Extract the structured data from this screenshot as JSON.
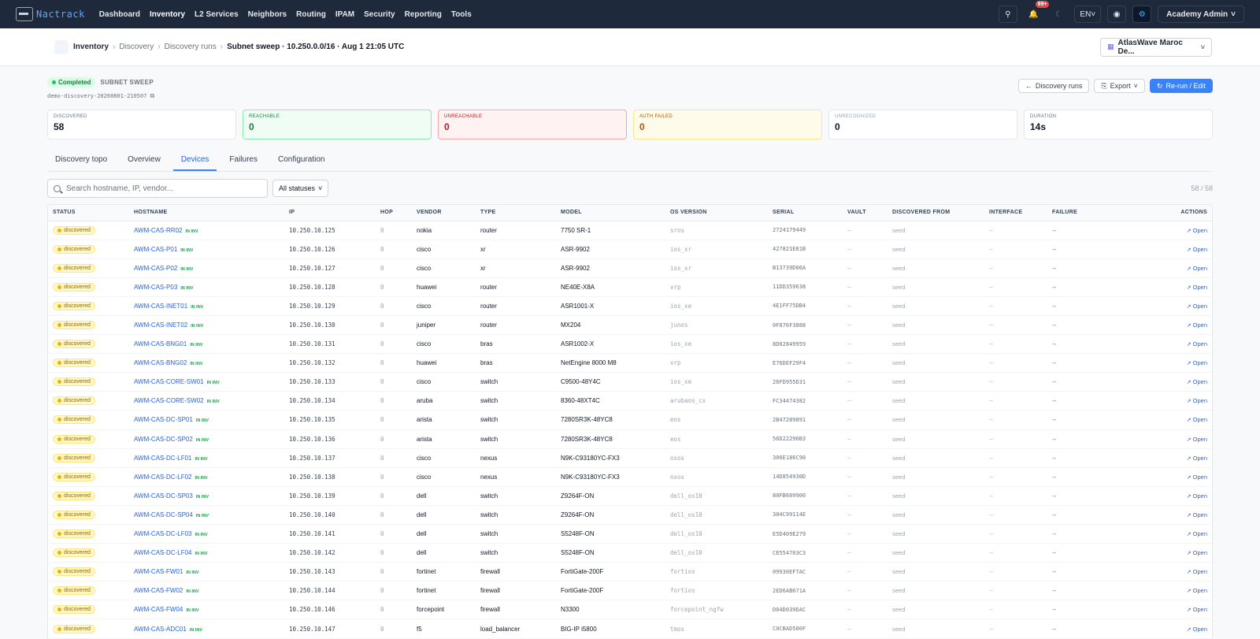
{
  "app": {
    "name": "Nactrack"
  },
  "nav": {
    "items": [
      "Dashboard",
      "Inventory",
      "L2 Services",
      "Neighbors",
      "Routing",
      "IPAM",
      "Security",
      "Reporting",
      "Tools"
    ],
    "notifications_badge": "99+",
    "language": "EN",
    "user": "Academy Admin"
  },
  "breadcrumb": [
    "Inventory",
    "Discovery",
    "Discovery runs",
    "Subnet sweep · 10.250.0.0/16 · Aug 1 21:05 UTC"
  ],
  "tenant": "AtlasWave Maroc De...",
  "run": {
    "status": "Completed",
    "kind": "SUBNET SWEEP",
    "id": "demo-discovery-20260801-210507"
  },
  "actions": {
    "back": "Discovery runs",
    "export": "Export",
    "rerun": "Re-run / Edit"
  },
  "stats": [
    {
      "label": "DISCOVERED",
      "value": "58",
      "tone": "default"
    },
    {
      "label": "REACHABLE",
      "value": "0",
      "tone": "green"
    },
    {
      "label": "UNREACHABLE",
      "value": "0",
      "tone": "red"
    },
    {
      "label": "AUTH FAILED",
      "value": "0",
      "tone": "yellow"
    },
    {
      "label": "UNRECOGNIZED",
      "value": "0",
      "tone": "grey"
    },
    {
      "label": "DURATION",
      "value": "14s",
      "tone": "default"
    }
  ],
  "tabs": [
    "Discovery topo",
    "Overview",
    "Devices",
    "Failures",
    "Configuration"
  ],
  "active_tab": 2,
  "toolbar": {
    "search_placeholder": "Search hostname, IP, vendor...",
    "status_filter": "All statuses",
    "count": "58 / 58"
  },
  "table": {
    "columns": [
      "STATUS",
      "HOSTNAME",
      "IP",
      "HOP",
      "VENDOR",
      "TYPE",
      "MODEL",
      "OS VERSION",
      "SERIAL",
      "VAULT",
      "DISCOVERED FROM",
      "INTERFACE",
      "FAILURE",
      "ACTIONS"
    ],
    "status_label": "discovered",
    "in_inv_label": "IN INV",
    "open_label": "Open",
    "dash": "--",
    "rows": [
      {
        "host": "AWM-CAS-RR02",
        "ip": "10.250.10.125",
        "hop": "0",
        "vendor": "nokia",
        "type": "router",
        "model": "7750 SR-1",
        "os": "sros",
        "serial": "2724179449",
        "from": "seed",
        "failure_red": false
      },
      {
        "host": "AWM-CAS-P01",
        "ip": "10.250.10.126",
        "hop": "0",
        "vendor": "cisco",
        "type": "xr",
        "model": "ASR-9902",
        "os": "ios_xr",
        "serial": "427821E81B",
        "from": "seed",
        "failure_red": false
      },
      {
        "host": "AWM-CAS-P02",
        "ip": "10.250.10.127",
        "hop": "0",
        "vendor": "cisco",
        "type": "xr",
        "model": "ASR-9902",
        "os": "ios_xr",
        "serial": "B13739D06A",
        "from": "seed",
        "failure_red": false
      },
      {
        "host": "AWM-CAS-P03",
        "ip": "10.250.10.128",
        "hop": "0",
        "vendor": "huawei",
        "type": "router",
        "model": "NE40E-X8A",
        "os": "vrp",
        "serial": "11DD359638",
        "from": "seed",
        "failure_red": false
      },
      {
        "host": "AWM-CAS-INET01",
        "ip": "10.250.10.129",
        "hop": "0",
        "vendor": "cisco",
        "type": "router",
        "model": "ASR1001-X",
        "os": "ios_xe",
        "serial": "4E1FF75DB4",
        "from": "seed",
        "failure_red": false
      },
      {
        "host": "AWM-CAS-INET02",
        "ip": "10.250.10.130",
        "hop": "0",
        "vendor": "juniper",
        "type": "router",
        "model": "MX204",
        "os": "junos",
        "serial": "0F876F3888",
        "from": "seed",
        "failure_red": false
      },
      {
        "host": "AWM-CAS-BNG01",
        "ip": "10.250.10.131",
        "hop": "0",
        "vendor": "cisco",
        "type": "bras",
        "model": "ASR1002-X",
        "os": "ios_xe",
        "serial": "8D02849959",
        "from": "seed",
        "failure_red": false
      },
      {
        "host": "AWM-CAS-BNG02",
        "ip": "10.250.10.132",
        "hop": "0",
        "vendor": "huawei",
        "type": "bras",
        "model": "NetEngine 8000 M8",
        "os": "vrp",
        "serial": "E76DEF29F4",
        "from": "seed",
        "failure_red": false
      },
      {
        "host": "AWM-CAS-CORE-SW01",
        "ip": "10.250.10.133",
        "hop": "0",
        "vendor": "cisco",
        "type": "switch",
        "model": "C9500-48Y4C",
        "os": "ios_xe",
        "serial": "26FD955D31",
        "from": "seed",
        "failure_red": false
      },
      {
        "host": "AWM-CAS-CORE-SW02",
        "ip": "10.250.10.134",
        "hop": "0",
        "vendor": "aruba",
        "type": "switch",
        "model": "8360-48XT4C",
        "os": "arubaos_cx",
        "serial": "FC34474382",
        "from": "seed",
        "failure_red": false
      },
      {
        "host": "AWM-CAS-DC-SP01",
        "ip": "10.250.10.135",
        "hop": "0",
        "vendor": "arista",
        "type": "switch",
        "model": "7280SR3K-48YC8",
        "os": "eos",
        "serial": "2B47289891",
        "from": "seed",
        "failure_red": false
      },
      {
        "host": "AWM-CAS-DC-SP02",
        "ip": "10.250.10.136",
        "hop": "0",
        "vendor": "arista",
        "type": "switch",
        "model": "7280SR3K-48YC8",
        "os": "eos",
        "serial": "56D22296B3",
        "from": "seed",
        "failure_red": false
      },
      {
        "host": "AWM-CAS-DC-LF01",
        "ip": "10.250.10.137",
        "hop": "0",
        "vendor": "cisco",
        "type": "nexus",
        "model": "N9K-C93180YC-FX3",
        "os": "nxos",
        "serial": "306E186C90",
        "from": "seed",
        "failure_red": false
      },
      {
        "host": "AWM-CAS-DC-LF02",
        "ip": "10.250.10.138",
        "hop": "0",
        "vendor": "cisco",
        "type": "nexus",
        "model": "N9K-C93180YC-FX3",
        "os": "nxos",
        "serial": "14D854930D",
        "from": "seed",
        "failure_red": false
      },
      {
        "host": "AWM-CAS-DC-SP03",
        "ip": "10.250.10.139",
        "hop": "0",
        "vendor": "dell",
        "type": "switch",
        "model": "Z9264F-ON",
        "os": "dell_os10",
        "serial": "80FB609900",
        "from": "seed",
        "failure_red": true
      },
      {
        "host": "AWM-CAS-DC-SP04",
        "ip": "10.250.10.140",
        "hop": "0",
        "vendor": "dell",
        "type": "switch",
        "model": "Z9264F-ON",
        "os": "dell_os10",
        "serial": "304C99114E",
        "from": "seed",
        "failure_red": false
      },
      {
        "host": "AWM-CAS-DC-LF03",
        "ip": "10.250.10.141",
        "hop": "0",
        "vendor": "dell",
        "type": "switch",
        "model": "S5248F-ON",
        "os": "dell_os10",
        "serial": "E5D409E279",
        "from": "seed",
        "failure_red": true
      },
      {
        "host": "AWM-CAS-DC-LF04",
        "ip": "10.250.10.142",
        "hop": "0",
        "vendor": "dell",
        "type": "switch",
        "model": "S5248F-ON",
        "os": "dell_os10",
        "serial": "CE554703C3",
        "from": "seed",
        "failure_red": false
      },
      {
        "host": "AWM-CAS-FW01",
        "ip": "10.250.10.143",
        "hop": "0",
        "vendor": "fortinet",
        "type": "firewall",
        "model": "FortiGate-200F",
        "os": "fortios",
        "serial": "09930EF7AC",
        "from": "seed",
        "failure_red": false
      },
      {
        "host": "AWM-CAS-FW02",
        "ip": "10.250.10.144",
        "hop": "0",
        "vendor": "fortinet",
        "type": "firewall",
        "model": "FortiGate-200F",
        "os": "fortios",
        "serial": "2ED6AB671A",
        "from": "seed",
        "failure_red": false
      },
      {
        "host": "AWM-CAS-FW04",
        "ip": "10.250.10.146",
        "hop": "0",
        "vendor": "forcepoint",
        "type": "firewall",
        "model": "N3300",
        "os": "forcepoint_ngfw",
        "serial": "D04D039DAC",
        "from": "seed",
        "failure_red": false
      },
      {
        "host": "AWM-CAS-ADC01",
        "ip": "10.250.10.147",
        "hop": "0",
        "vendor": "f5",
        "type": "load_balancer",
        "model": "BIG-IP i5800",
        "os": "tmos",
        "serial": "C0CBAD500F",
        "from": "seed",
        "failure_red": false
      }
    ]
  },
  "colors": {
    "nav_bg": "#1e293b",
    "accent": "#3b82f6",
    "link": "#2563eb"
  }
}
